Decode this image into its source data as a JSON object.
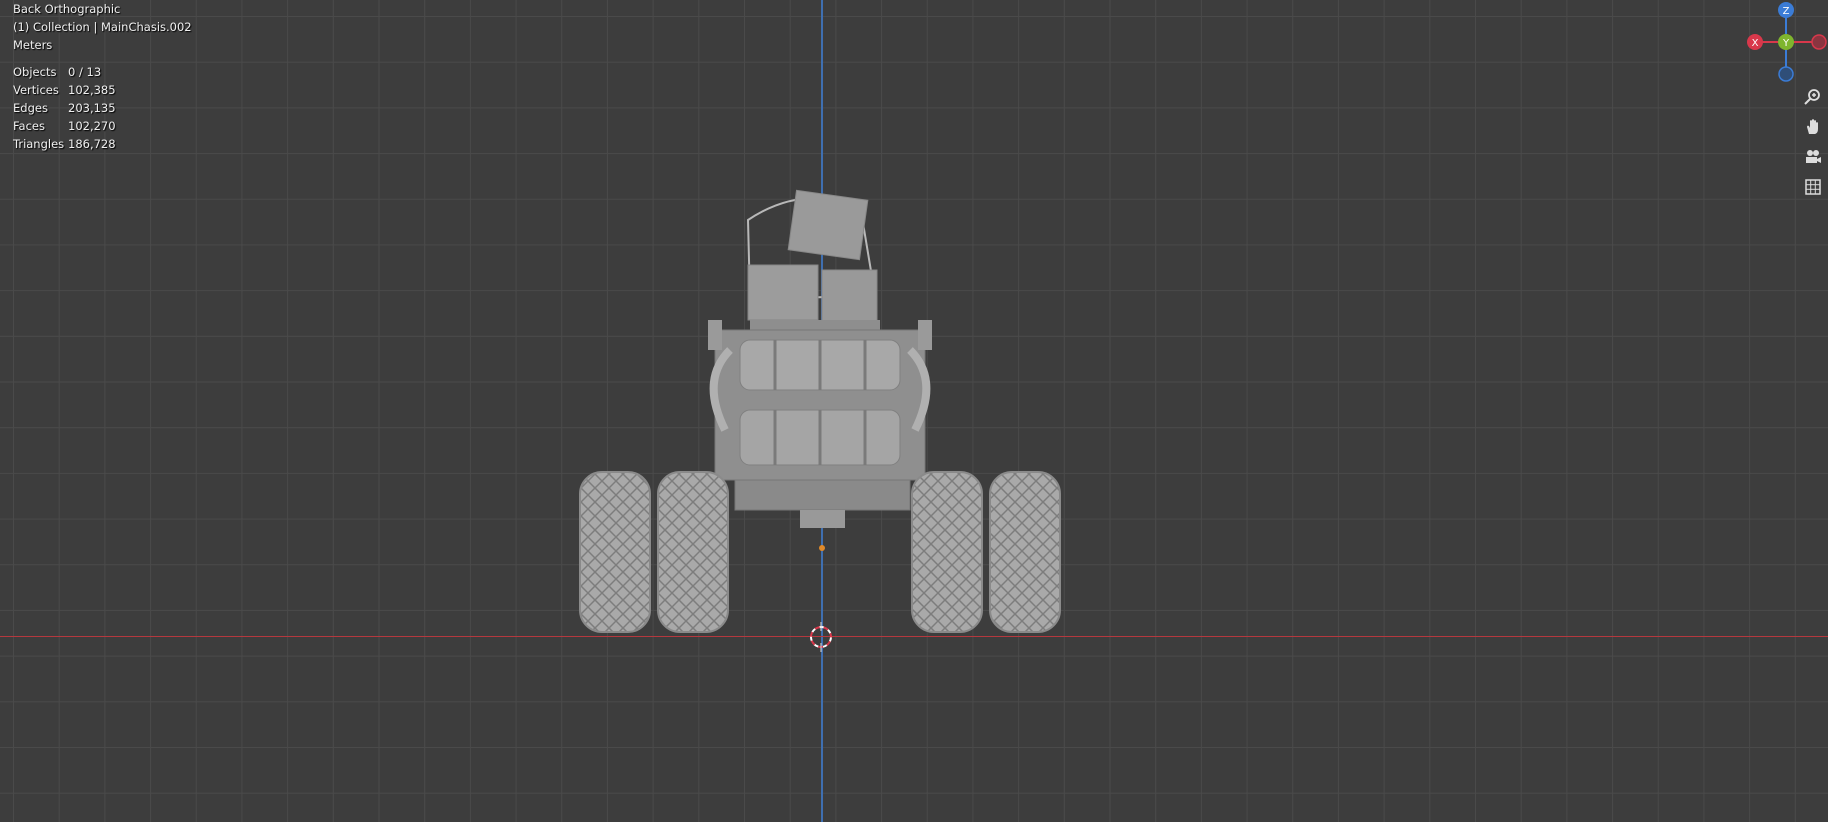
{
  "viewport": {
    "view_name": "Back Orthographic",
    "collection_info": "(1) Collection | MainChasis.002",
    "units": "Meters"
  },
  "stats": [
    {
      "label": "Objects",
      "value": "0 / 13"
    },
    {
      "label": "Vertices",
      "value": "102,385"
    },
    {
      "label": "Edges",
      "value": "203,135"
    },
    {
      "label": "Faces",
      "value": "102,270"
    },
    {
      "label": "Triangles",
      "value": "186,728"
    }
  ],
  "gizmo": {
    "z_label": "Z",
    "x_label": "X",
    "y_label": "Y",
    "colors": {
      "z": "#3b7cd6",
      "x": "#d8384b",
      "y": "#7fb52e"
    }
  },
  "nav_tools": [
    "zoom-icon",
    "hand-pan-icon",
    "camera-icon",
    "grid-icon"
  ]
}
